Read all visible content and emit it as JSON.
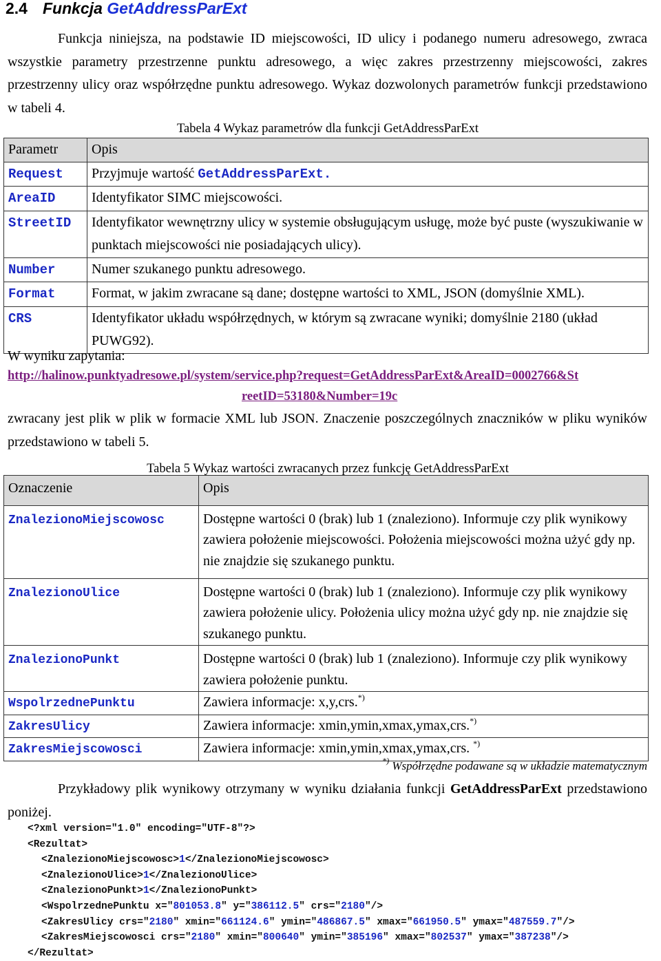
{
  "heading": {
    "number": "2.4",
    "prefix": "Funkcja",
    "function_name": "GetAddressParExt"
  },
  "intro_paragraph": "Funkcja niniejsza, na podstawie ID miejscowości, ID ulicy i podanego numeru adresowego, zwraca wszystkie parametry przestrzenne punktu adresowego, a więc zakres przestrzenny miejscowości, zakres przestrzenny ulicy oraz współrzędne punktu adresowego. Wykaz dozwolonych parametrów funkcji przedstawiono w tabeli 4.",
  "table4": {
    "caption": "Tabela 4 Wykaz parametrów dla funkcji GetAddressParExt",
    "headers": [
      "Parametr",
      "Opis"
    ],
    "rows": [
      {
        "param": "Request",
        "desc_prefix": "Przyjmuje wartość ",
        "desc_code": "GetAddressParExt.",
        "desc": ""
      },
      {
        "param": "AreaID",
        "desc": "Identyfikator SIMC miejscowości."
      },
      {
        "param": "StreetID",
        "desc": "Identyfikator wewnętrzny ulicy w systemie obsługującym usługę, może być puste (wyszukiwanie w punktach miejscowości nie posiadających ulicy)."
      },
      {
        "param": "Number",
        "desc": "Numer szukanego punktu adresowego."
      },
      {
        "param": "Format",
        "desc": "Format, w jakim zwracane są dane; dostępne wartości to XML, JSON (domyślnie XML)."
      },
      {
        "param": "CRS",
        "desc": "Identyfikator układu współrzędnych, w którym są zwracane wyniki; domyślnie 2180 (układ PUWG92)."
      }
    ]
  },
  "query_label": "W wyniku zapytania:",
  "query_url_line1": "http://halinow.punktyadresowe.pl/system/service.php?request=GetAddressParExt&AreaID=0002766&St",
  "query_url_line2": "reetID=53180&Number=19c",
  "result_paragraph": "zwracany jest plik w plik w formacie XML lub JSON. Znaczenie poszczególnych znaczników w pliku wyników przedstawiono w tabeli 5.",
  "table5": {
    "caption": "Tabela 5 Wykaz wartości zwracanych przez funkcję GetAddressParExt",
    "headers": [
      "Oznaczenie",
      "Opis"
    ],
    "rows": [
      {
        "name": "ZnalezionoMiejscowosc",
        "desc": "Dostępne wartości 0 (brak) lub 1 (znaleziono). Informuje czy plik wynikowy zawiera położenie miejscowości. Położenia miejscowości można użyć gdy np. nie znajdzie się szukanego punktu.",
        "sup": ""
      },
      {
        "name": "ZnalezionoUlice",
        "desc": "Dostępne wartości 0 (brak) lub 1 (znaleziono). Informuje czy plik wynikowy zawiera położenie ulicy. Położenia ulicy można użyć gdy np. nie znajdzie się szukanego punktu.",
        "sup": ""
      },
      {
        "name": "ZnalezionoPunkt",
        "desc": "Dostępne wartości 0 (brak) lub 1 (znaleziono). Informuje czy plik wynikowy zawiera położenie punktu.",
        "sup": ""
      },
      {
        "name": "WspolrzednePunktu",
        "desc": "Zawiera informacje: x,y,crs.",
        "sup": "*)"
      },
      {
        "name": "ZakresUlicy",
        "desc": "Zawiera informacje:  xmin,ymin,xmax,ymax,crs.",
        "sup": "*)"
      },
      {
        "name": "ZakresMiejscowosci",
        "desc": "Zawiera informacje:  xmin,ymin,xmax,ymax,crs. ",
        "sup": "*)"
      }
    ]
  },
  "footnote": {
    "mark": "*)",
    "text": " Współrzędne podawane są w układzie matematycznym"
  },
  "example_paragraph": {
    "text": "Przykładowy plik wynikowy otrzymany w wyniku działania funkcji ",
    "bold": "GetAddressParExt",
    "text_end": " przedstawiono poniżej."
  },
  "xml_example": {
    "declaration": "<?xml version=\"1.0\" encoding=\"UTF-8\"?>",
    "root_open": "<Rezultat>",
    "root_close": "</Rezultat>",
    "znaleziono_miejscowosc": "1",
    "znaleziono_ulice": "1",
    "znaleziono_punkt": "1",
    "punkt": {
      "x": "801053.8",
      "y": "386112.5",
      "crs": "2180"
    },
    "zakres_ulicy": {
      "crs": "2180",
      "xmin": "661124.6",
      "ymin": "486867.5",
      "xmax": "661950.5",
      "ymax": "487559.7"
    },
    "zakres_miejscowosci": {
      "crs": "2180",
      "xmin": "800640",
      "ymin": "385196",
      "xmax": "802537",
      "ymax": "387238"
    }
  },
  "colors": {
    "function_name": "#1a2fd6",
    "code_identifier": "#1a28c4",
    "link": "#7a1d7e",
    "table_header_bg": "#d9d9d9"
  }
}
